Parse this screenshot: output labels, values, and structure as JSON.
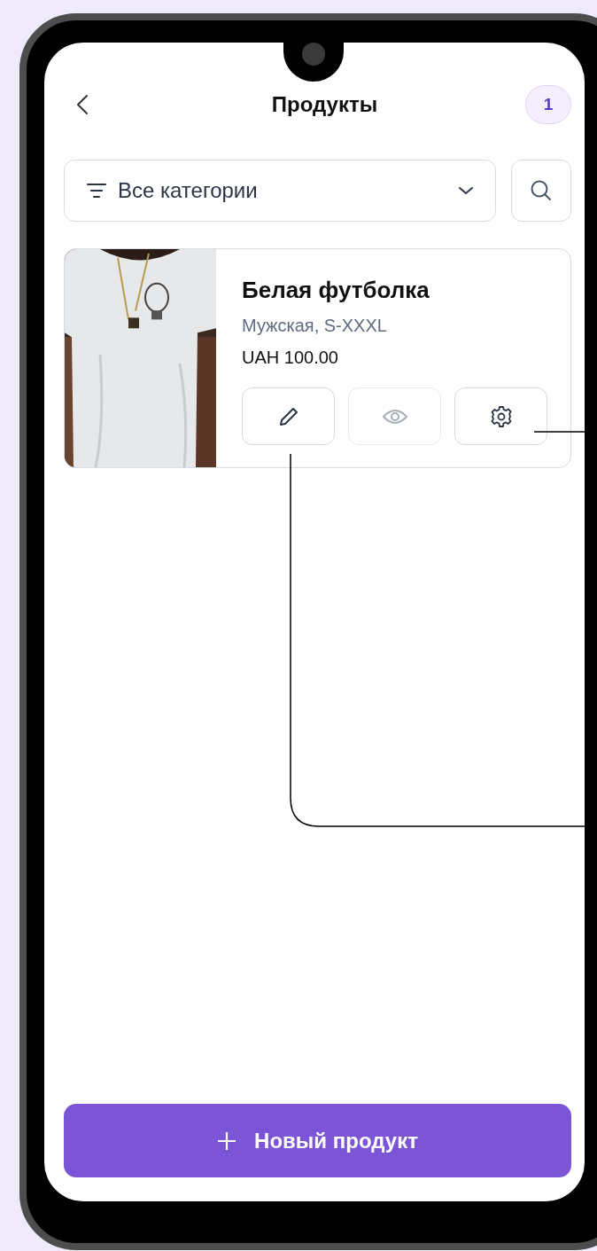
{
  "header": {
    "title": "Продукты",
    "badge": "1"
  },
  "filter": {
    "value": "Все категории"
  },
  "products": [
    {
      "title": "Белая футболка",
      "subtitle": "Мужская, S-XXXL",
      "price": "UAH 100.00",
      "actions": [
        {
          "kind": "edit",
          "disabled": false
        },
        {
          "kind": "view",
          "disabled": true
        },
        {
          "kind": "settings",
          "disabled": false
        }
      ]
    }
  ],
  "add_button": {
    "label": "Новый продукт"
  }
}
